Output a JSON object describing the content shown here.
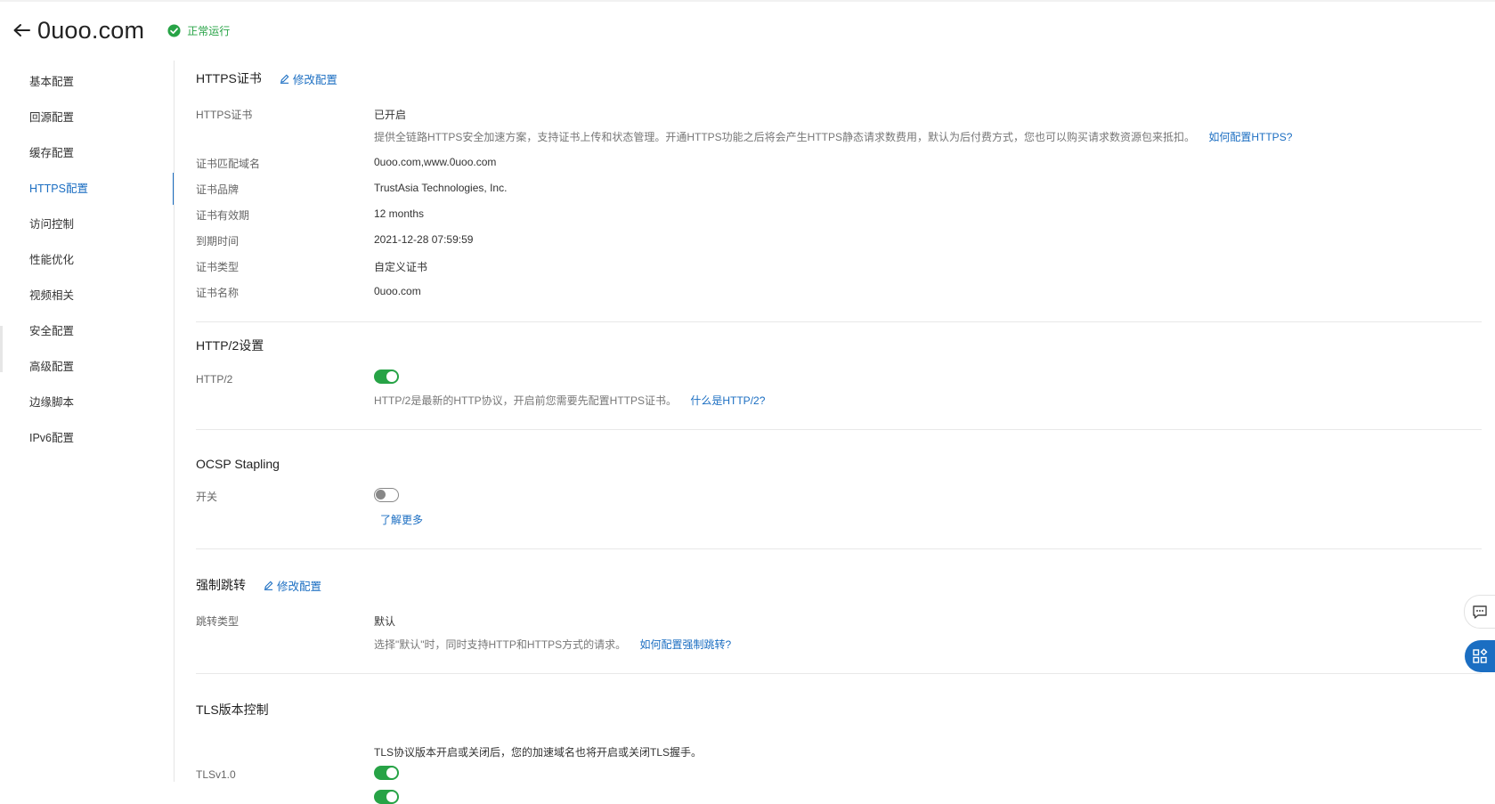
{
  "header": {
    "domain": "0uoo.com",
    "status": "正常运行",
    "status_color": "#27a346"
  },
  "sidebar": {
    "items": [
      {
        "label": "基本配置",
        "active": false
      },
      {
        "label": "回源配置",
        "active": false
      },
      {
        "label": "缓存配置",
        "active": false
      },
      {
        "label": "HTTPS配置",
        "active": true
      },
      {
        "label": "访问控制",
        "active": false
      },
      {
        "label": "性能优化",
        "active": false
      },
      {
        "label": "视频相关",
        "active": false
      },
      {
        "label": "安全配置",
        "active": false
      },
      {
        "label": "高级配置",
        "active": false
      },
      {
        "label": "边缘脚本",
        "active": false
      },
      {
        "label": "IPv6配置",
        "active": false
      }
    ]
  },
  "https_cert": {
    "title": "HTTPS证书",
    "edit_label": "修改配置",
    "rows": [
      {
        "label": "HTTPS证书",
        "value": "已开启"
      },
      {
        "label": "证书匹配域名",
        "value": "0uoo.com,www.0uoo.com"
      },
      {
        "label": "证书品牌",
        "value": "TrustAsia Technologies, Inc."
      },
      {
        "label": "证书有效期",
        "value": "12 months"
      },
      {
        "label": "到期时间",
        "value": "2021-12-28 07:59:59"
      },
      {
        "label": "证书类型",
        "value": "自定义证书"
      },
      {
        "label": "证书名称",
        "value": "0uoo.com"
      }
    ],
    "desc": "提供全链路HTTPS安全加速方案，支持证书上传和状态管理。开通HTTPS功能之后将会产生HTTPS静态请求数费用，默认为后付费方式，您也可以购买请求数资源包来抵扣。",
    "help_link": "如何配置HTTPS?"
  },
  "http2": {
    "title": "HTTP/2设置",
    "label": "HTTP/2",
    "enabled": true,
    "desc": "HTTP/2是最新的HTTP协议，开启前您需要先配置HTTPS证书。",
    "help_link": "什么是HTTP/2?"
  },
  "ocsp": {
    "title": "OCSP Stapling",
    "label": "开关",
    "enabled": false,
    "learn_more": "了解更多"
  },
  "redirect": {
    "title": "强制跳转",
    "edit_label": "修改配置",
    "label": "跳转类型",
    "value": "默认",
    "desc": "选择\"默认\"时，同时支持HTTP和HTTPS方式的请求。",
    "help_link": "如何配置强制跳转?"
  },
  "tls": {
    "title": "TLS版本控制",
    "desc": "TLS协议版本开启或关闭后，您的加速域名也将开启或关闭TLS握手。",
    "versions": [
      {
        "label": "TLSv1.0",
        "enabled": true
      }
    ]
  },
  "floating": {
    "feedback_icon": "message-icon",
    "apps_icon": "apps-grid-icon"
  },
  "colors": {
    "accent": "#1b6ec2",
    "toggle_on": "#27a346"
  }
}
